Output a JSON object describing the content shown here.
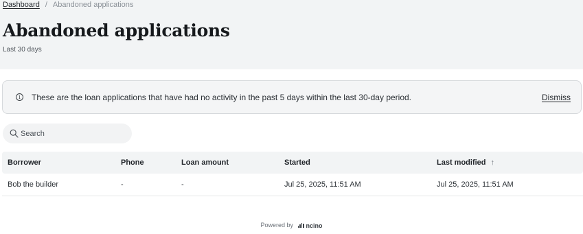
{
  "breadcrumb": {
    "home": "Dashboard",
    "separator": "/",
    "current": "Abandoned applications"
  },
  "page": {
    "title": "Abandoned applications",
    "subtitle": "Last 30 days"
  },
  "banner": {
    "icon": "info-icon",
    "text": "These are the loan applications that have had no activity in the past 5 days within the last 30-day period.",
    "dismiss_label": "Dismiss"
  },
  "search": {
    "placeholder": "Search",
    "value": "",
    "icon": "search-icon"
  },
  "table": {
    "columns": {
      "borrower": "Borrower",
      "phone": "Phone",
      "loan_amount": "Loan amount",
      "started": "Started",
      "last_modified": "Last modified"
    },
    "sort": {
      "column": "last_modified",
      "direction": "ascending",
      "icon": "arrow-up-icon",
      "glyph": "↑"
    },
    "rows": [
      {
        "borrower": "Bob the builder",
        "phone": "-",
        "loan_amount": "-",
        "started": "Jul 25, 2025, 11:51 AM",
        "last_modified": "Jul 25, 2025, 11:51 AM"
      }
    ]
  },
  "footer": {
    "powered_by": "Powered by",
    "brand": "ncino"
  },
  "colors": {
    "header_bg": "#f2f4f5",
    "banner_bg": "#f4f5f6",
    "banner_border": "#d6d9dc",
    "text_primary": "#1f2328",
    "text_muted": "#6b7178"
  }
}
